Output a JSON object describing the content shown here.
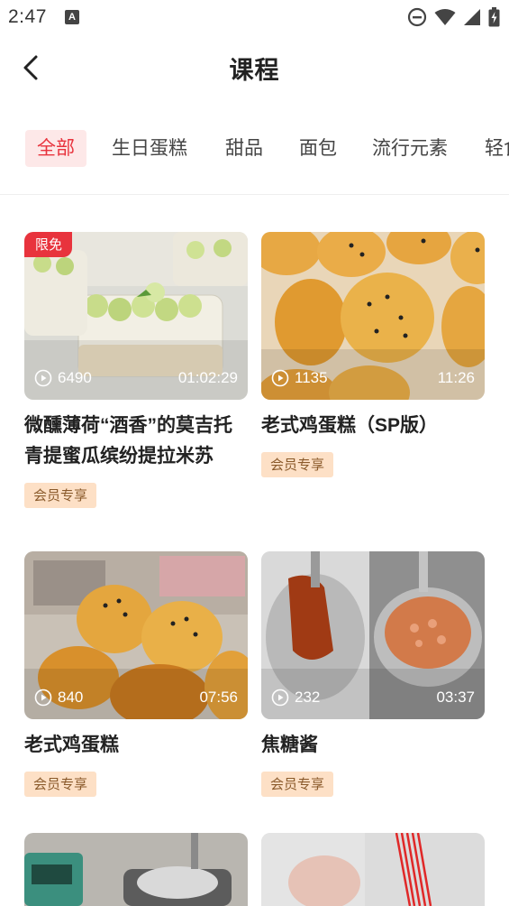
{
  "status_bar": {
    "time": "2:47",
    "notification_glyph": "A"
  },
  "header": {
    "title": "课程"
  },
  "tabs": [
    {
      "label": "全部",
      "active": true
    },
    {
      "label": "生日蛋糕",
      "active": false
    },
    {
      "label": "甜品",
      "active": false
    },
    {
      "label": "面包",
      "active": false
    },
    {
      "label": "流行元素",
      "active": false
    },
    {
      "label": "轻食",
      "active": false
    }
  ],
  "courses": [
    {
      "title": "微醺薄荷“酒香”的莫吉托青提蜜瓜缤纷提拉米苏",
      "plays": "6490",
      "duration": "01:02:29",
      "badge": "限免",
      "tag": "会员专享",
      "thumb_icon": "mojito-tiramisu-image"
    },
    {
      "title": "老式鸡蛋糕（SP版）",
      "plays": "1135",
      "duration": "11:26",
      "badge": "",
      "tag": "会员专享",
      "thumb_icon": "madeleine-cakes-image"
    },
    {
      "title": "老式鸡蛋糕",
      "plays": "840",
      "duration": "07:56",
      "badge": "",
      "tag": "会员专享",
      "thumb_icon": "sponge-cakes-image"
    },
    {
      "title": "焦糖酱",
      "plays": "232",
      "duration": "03:37",
      "badge": "",
      "tag": "会员专享",
      "thumb_icon": "caramel-sauce-image"
    },
    {
      "title": "",
      "plays": "",
      "duration": "",
      "badge": "",
      "tag": "",
      "thumb_icon": "scale-pot-image"
    },
    {
      "title": "",
      "plays": "",
      "duration": "",
      "badge": "",
      "tag": "",
      "thumb_icon": "sugar-craft-image"
    }
  ],
  "colors": {
    "accent": "#e8333d",
    "accent_bg": "#fde8e8",
    "member_tag_bg": "#fde0c6",
    "member_tag_text": "#8a5a2b"
  }
}
